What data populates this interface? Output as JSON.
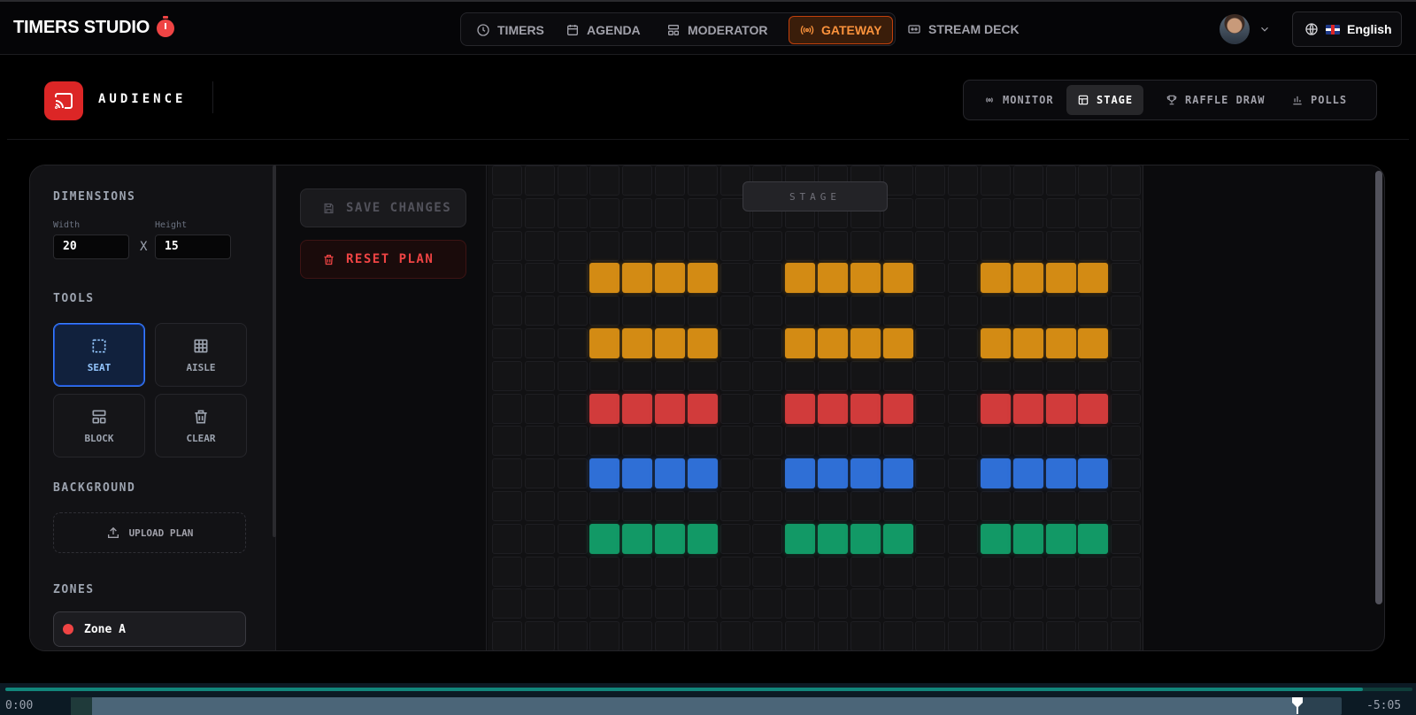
{
  "app": {
    "brand": "TIMERS STUDIO",
    "brand_icon": "stopwatch-icon"
  },
  "nav": {
    "tabs": [
      {
        "label": "TIMERS",
        "icon": "clock-icon"
      },
      {
        "label": "AGENDA",
        "icon": "calendar-icon"
      },
      {
        "label": "MODERATOR",
        "icon": "layout-icon"
      },
      {
        "label": "GATEWAY",
        "icon": "broadcast-icon",
        "active": true
      }
    ],
    "extra": {
      "label": "STREAM DECK",
      "icon": "stream-deck-icon"
    }
  },
  "user": {
    "avatar": "user-avatar",
    "language": "English"
  },
  "section": {
    "title": "AUDIENCE",
    "icon": "cast-icon",
    "modes": [
      {
        "label": "MONITOR",
        "icon": "radio-icon"
      },
      {
        "label": "STAGE",
        "icon": "layout-icon",
        "active": true
      },
      {
        "label": "RAFFLE DRAW",
        "icon": "trophy-icon"
      },
      {
        "label": "POLLS",
        "icon": "bar-chart-icon"
      }
    ]
  },
  "sidebar": {
    "dimensions_label": "DIMENSIONS",
    "width_label": "Width",
    "height_label": "Height",
    "width_value": "20",
    "height_value": "15",
    "times_symbol": "X",
    "tools_label": "TOOLS",
    "tools": [
      {
        "label": "SEAT",
        "icon": "seat-select-icon",
        "active": true
      },
      {
        "label": "AISLE",
        "icon": "grid-icon"
      },
      {
        "label": "BLOCK",
        "icon": "block-icon"
      },
      {
        "label": "CLEAR",
        "icon": "trash-icon"
      }
    ],
    "background_label": "BACKGROUND",
    "upload_label": "UPLOAD PLAN",
    "zones_label": "ZONES",
    "zones": [
      {
        "name": "Zone A",
        "color": "#ef4444"
      }
    ]
  },
  "actions": {
    "save_label": "SAVE CHANGES",
    "reset_label": "RESET PLAN"
  },
  "seating": {
    "stage_label": "STAGE",
    "cols": 20,
    "visible_rows": 15,
    "seat_rows": [
      {
        "row": 3,
        "color": "#d38b14"
      },
      {
        "row": 5,
        "color": "#d38b14"
      },
      {
        "row": 7,
        "color": "#d13b3b"
      },
      {
        "row": 9,
        "color": "#2f6fd6"
      },
      {
        "row": 11,
        "color": "#129966"
      }
    ],
    "seat_col_blocks": [
      [
        3,
        6
      ],
      [
        9,
        12
      ],
      [
        15,
        18
      ]
    ]
  },
  "player": {
    "time_elapsed": "0:00",
    "time_remaining": "-5:05",
    "progress": 0.965
  }
}
